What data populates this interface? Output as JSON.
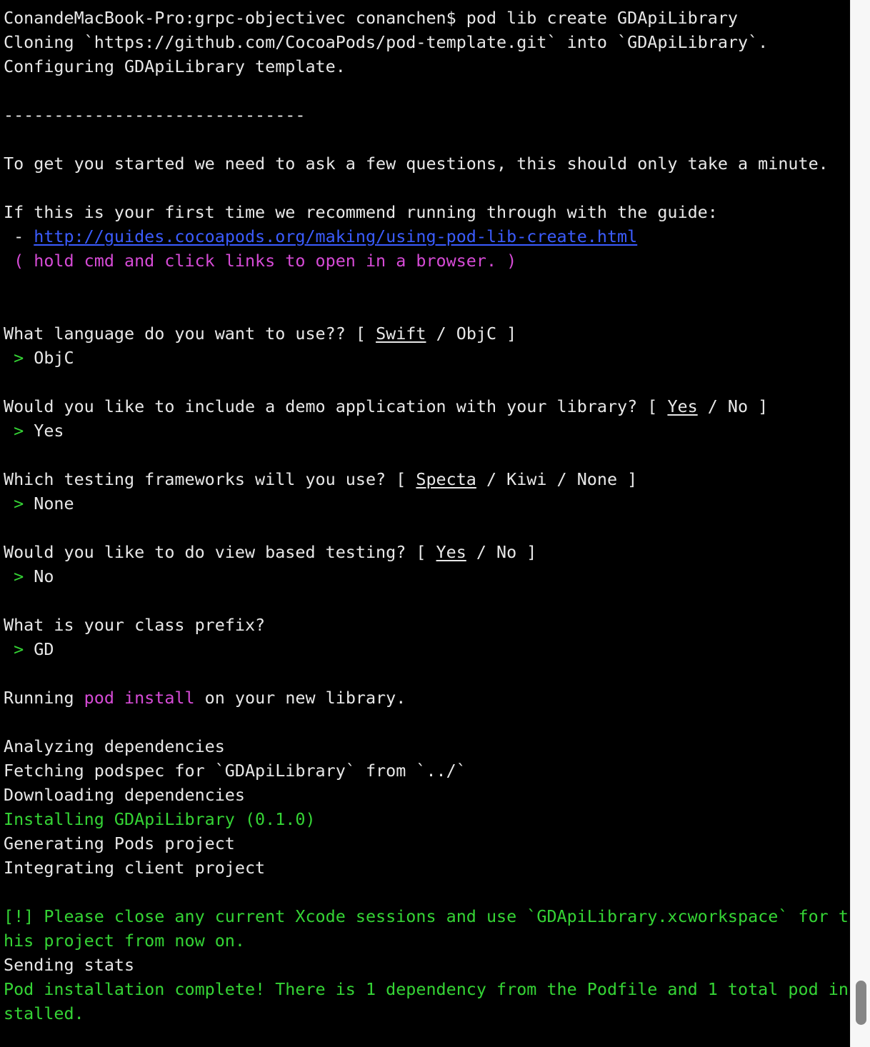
{
  "colors": {
    "background": "#000000",
    "text": "#e8e8e8",
    "green": "#35d435",
    "magenta": "#d64bd6",
    "link_blue": "#3b5cff",
    "scrollbar_track": "#f7f7f7",
    "scrollbar_thumb": "#858585"
  },
  "lines": [
    [
      {
        "t": "ConandeMacBook-Pro:grpc-objectivec conanchen$ pod lib create GDApiLibrary"
      }
    ],
    [
      {
        "t": "Cloning `https://github.com/CocoaPods/pod-template.git` into `GDApiLibrary`."
      }
    ],
    [
      {
        "t": "Configuring GDApiLibrary template."
      }
    ],
    [
      {
        "t": ""
      }
    ],
    [
      {
        "t": "------------------------------"
      }
    ],
    [
      {
        "t": ""
      }
    ],
    [
      {
        "t": "To get you started we need to ask a few questions, this should only take a minute."
      }
    ],
    [
      {
        "t": ""
      }
    ],
    [
      {
        "t": "If this is your first time we recommend running through with the guide:"
      }
    ],
    [
      {
        "t": " - "
      },
      {
        "t": "http://guides.cocoapods.org/making/using-pod-lib-create.html",
        "c": "link"
      }
    ],
    [
      {
        "t": " ( hold cmd and click links to open in a browser. )",
        "c": "magenta"
      }
    ],
    [
      {
        "t": ""
      }
    ],
    [
      {
        "t": ""
      }
    ],
    [
      {
        "t": "What language do you want to use?? [ "
      },
      {
        "t": "Swift",
        "u": true
      },
      {
        "t": " / ObjC ]"
      }
    ],
    [
      {
        "t": " > ",
        "c": "green"
      },
      {
        "t": "ObjC"
      }
    ],
    [
      {
        "t": ""
      }
    ],
    [
      {
        "t": "Would you like to include a demo application with your library? [ "
      },
      {
        "t": "Yes",
        "u": true
      },
      {
        "t": " / No ]"
      }
    ],
    [
      {
        "t": " > ",
        "c": "green"
      },
      {
        "t": "Yes"
      }
    ],
    [
      {
        "t": ""
      }
    ],
    [
      {
        "t": "Which testing frameworks will you use? [ "
      },
      {
        "t": "Specta",
        "u": true
      },
      {
        "t": " / Kiwi / None ]"
      }
    ],
    [
      {
        "t": " > ",
        "c": "green"
      },
      {
        "t": "None"
      }
    ],
    [
      {
        "t": ""
      }
    ],
    [
      {
        "t": "Would you like to do view based testing? [ "
      },
      {
        "t": "Yes",
        "u": true
      },
      {
        "t": " / No ]"
      }
    ],
    [
      {
        "t": " > ",
        "c": "green"
      },
      {
        "t": "No"
      }
    ],
    [
      {
        "t": ""
      }
    ],
    [
      {
        "t": "What is your class prefix?"
      }
    ],
    [
      {
        "t": " > ",
        "c": "green"
      },
      {
        "t": "GD"
      }
    ],
    [
      {
        "t": ""
      }
    ],
    [
      {
        "t": "Running "
      },
      {
        "t": "pod install",
        "c": "magenta"
      },
      {
        "t": " on your new library."
      }
    ],
    [
      {
        "t": ""
      }
    ],
    [
      {
        "t": "Analyzing dependencies"
      }
    ],
    [
      {
        "t": "Fetching podspec for `GDApiLibrary` from `../`"
      }
    ],
    [
      {
        "t": "Downloading dependencies"
      }
    ],
    [
      {
        "t": "Installing GDApiLibrary (0.1.0)",
        "c": "green"
      }
    ],
    [
      {
        "t": "Generating Pods project"
      }
    ],
    [
      {
        "t": "Integrating client project"
      }
    ],
    [
      {
        "t": ""
      }
    ],
    [
      {
        "t": "[!] Please close any current Xcode sessions and use `GDApiLibrary.xcworkspace` for t",
        "c": "green"
      }
    ],
    [
      {
        "t": "his project from now on.",
        "c": "green"
      }
    ],
    [
      {
        "t": "Sending stats"
      }
    ],
    [
      {
        "t": "Pod installation complete! There is 1 dependency from the Podfile and 1 total pod in",
        "c": "green"
      }
    ],
    [
      {
        "t": "stalled.",
        "c": "green"
      }
    ]
  ]
}
